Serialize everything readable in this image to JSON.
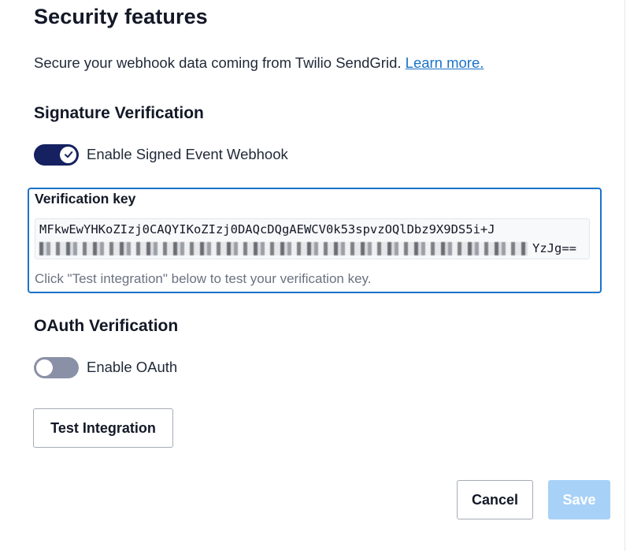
{
  "section": {
    "title": "Security features",
    "intro_text": "Secure your webhook data coming from Twilio SendGrid.",
    "learn_more_link": "Learn more."
  },
  "signature": {
    "heading": "Signature Verification",
    "toggle_label": "Enable Signed Event Webhook",
    "toggle_state": "on",
    "key_label": "Verification key",
    "key_line1": "MFkwEwYHKoZIzj0CAQYIKoZIzj0DAQcDQgAEWCV0k53spvzOQlDbz9X9DS5i+J",
    "key_line2_tail": "YzJg==",
    "key_help": "Click \"Test integration\" below to test your verification key."
  },
  "oauth": {
    "heading": "OAuth Verification",
    "toggle_label": "Enable OAuth",
    "toggle_state": "off"
  },
  "actions": {
    "test_label": "Test Integration",
    "cancel_label": "Cancel",
    "save_label": "Save",
    "save_disabled": true
  },
  "colors": {
    "toggle_on": "#152160",
    "toggle_off": "#8a90a6",
    "accent": "#1a73c8",
    "save_disabled_bg": "#a8d1f7"
  },
  "icons": {
    "toggle_on_knob": "check-icon"
  }
}
